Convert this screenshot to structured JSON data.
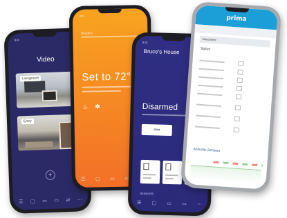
{
  "phone_video": {
    "title": "Video",
    "camera_1_label": "Livingroom",
    "camera_2_label": "Entry",
    "add_button": "+",
    "tabs": [
      "☰",
      "▢",
      "▭",
      "▭",
      "⇄",
      "⋯"
    ]
  },
  "phone_thermostat": {
    "name": "Bruce's",
    "setpoint": "Set to 72°",
    "icons": [
      "♨",
      "✽"
    ],
    "tabs": [
      "☰",
      "▢",
      "▭",
      "▭",
      "⋯"
    ],
    "slider_level": 0.55
  },
  "phone_security": {
    "title": "Bruce's House",
    "state": "Disarmed",
    "arm_button": "Arm",
    "sensors_label": "SENSORS",
    "tabs": [
      "☰",
      "▢",
      "▭",
      "▭",
      "⋯"
    ]
  },
  "phone_prima": {
    "brand": "prima",
    "section": "Disconnect",
    "subheading": "Status",
    "footer": "Acoustic Sensors"
  }
}
